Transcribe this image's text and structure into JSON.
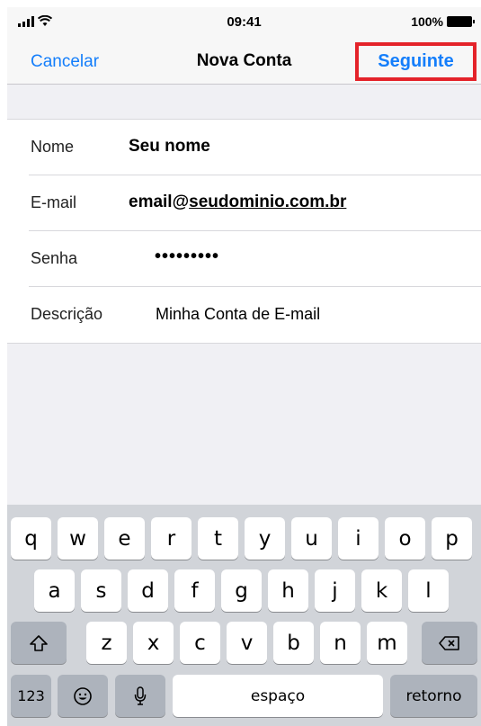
{
  "status_bar": {
    "time": "09:41",
    "battery": "100%"
  },
  "nav": {
    "cancel": "Cancelar",
    "title": "Nova Conta",
    "next": "Seguinte"
  },
  "form": {
    "name": {
      "label": "Nome",
      "value": "Seu nome"
    },
    "email": {
      "label": "E-mail",
      "prefix": "email@",
      "domain": "seudominio.com.br"
    },
    "password": {
      "label": "Senha",
      "value": "•••••••••"
    },
    "description": {
      "label": "Descrição",
      "value": "Minha Conta de E-mail"
    }
  },
  "keyboard": {
    "row1": [
      "q",
      "w",
      "e",
      "r",
      "t",
      "y",
      "u",
      "i",
      "o",
      "p"
    ],
    "row2": [
      "a",
      "s",
      "d",
      "f",
      "g",
      "h",
      "j",
      "k",
      "l"
    ],
    "row3": [
      "z",
      "x",
      "c",
      "v",
      "b",
      "n",
      "m"
    ],
    "numbers": "123",
    "space": "espaço",
    "return": "retorno"
  },
  "icons": {
    "signal": "signal-icon",
    "wifi": "wifi-icon",
    "battery": "battery-icon",
    "shift": "shift-icon",
    "backspace": "backspace-icon",
    "emoji": "emoji-icon",
    "mic": "microphone-icon"
  },
  "colors": {
    "accent": "#147efb",
    "highlight": "#e4232a"
  }
}
